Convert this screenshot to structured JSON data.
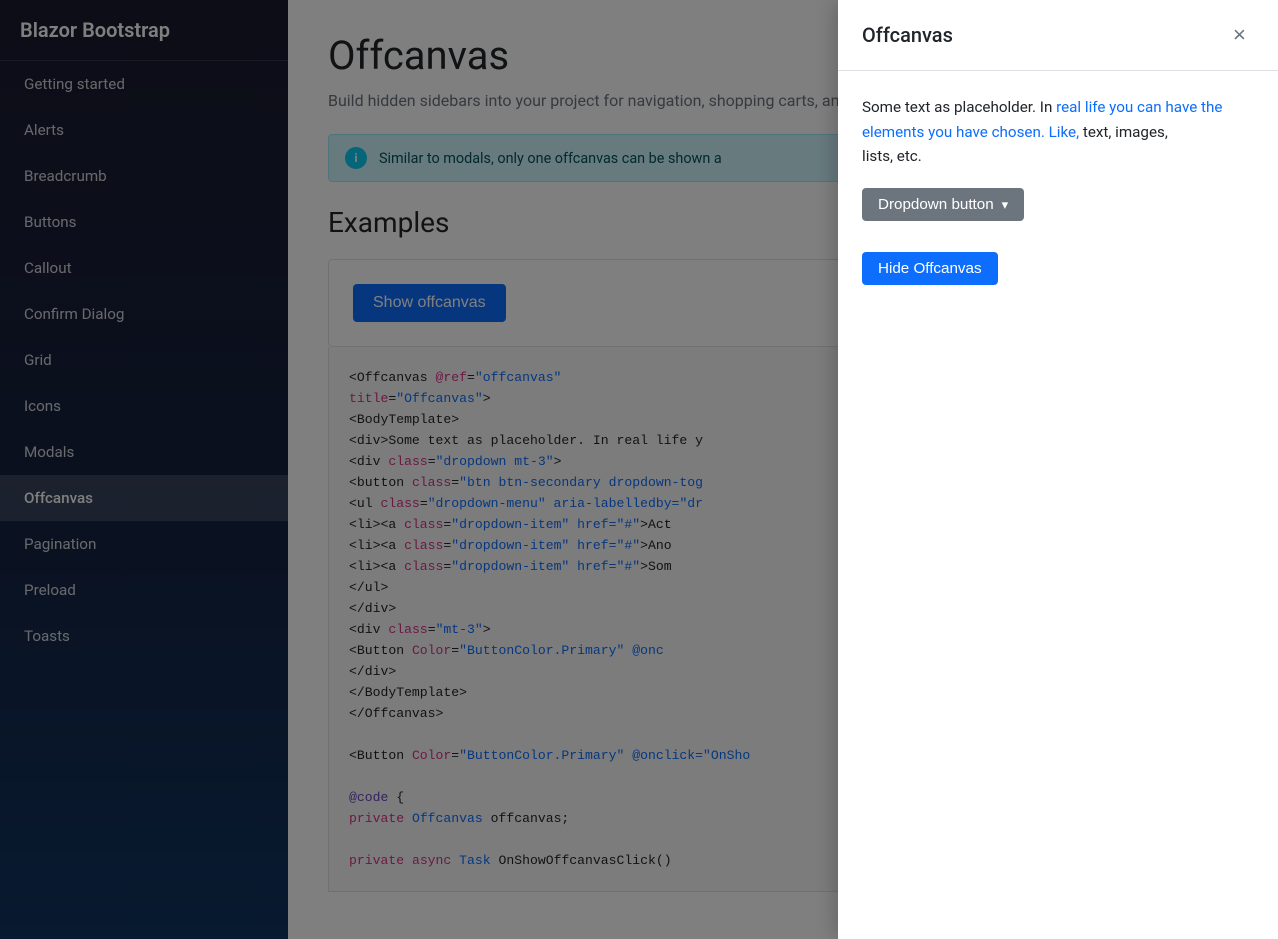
{
  "app": {
    "title": "Blazor Bootstrap"
  },
  "sidebar": {
    "items": [
      {
        "id": "getting-started",
        "label": "Getting started",
        "active": false
      },
      {
        "id": "alerts",
        "label": "Alerts",
        "active": false
      },
      {
        "id": "breadcrumb",
        "label": "Breadcrumb",
        "active": false
      },
      {
        "id": "buttons",
        "label": "Buttons",
        "active": false
      },
      {
        "id": "callout",
        "label": "Callout",
        "active": false
      },
      {
        "id": "confirm-dialog",
        "label": "Confirm Dialog",
        "active": false
      },
      {
        "id": "grid",
        "label": "Grid",
        "active": false
      },
      {
        "id": "icons",
        "label": "Icons",
        "active": false
      },
      {
        "id": "modals",
        "label": "Modals",
        "active": false
      },
      {
        "id": "offcanvas",
        "label": "Offcanvas",
        "active": true
      },
      {
        "id": "pagination",
        "label": "Pagination",
        "active": false
      },
      {
        "id": "preload",
        "label": "Preload",
        "active": false
      },
      {
        "id": "toasts",
        "label": "Toasts",
        "active": false
      }
    ]
  },
  "main": {
    "page_title": "Offcanvas",
    "page_subtitle": "Build hidden sidebars into your project for navigation, shopping carts, and more.",
    "info_text": "Similar to modals, only one offcanvas can be shown a",
    "examples_title": "Examples",
    "show_btn_label": "Show offcanvas"
  },
  "offcanvas": {
    "title": "Offcanvas",
    "body_text_plain": "Some text as placeholder. In real life you can have the elements you have chosen. Like, text, images, lists, etc.",
    "body_text_highlighted_words": [
      "real",
      "life",
      "you",
      "can",
      "have",
      "the",
      "elements",
      "you",
      "have",
      "chosen.",
      "Like,",
      "text,",
      "images,"
    ],
    "dropdown_btn_label": "Dropdown button",
    "hide_btn_label": "Hide Offcanvas",
    "close_icon": "×"
  },
  "code": {
    "lines": [
      {
        "parts": [
          {
            "type": "tag",
            "text": "<Offcanvas "
          },
          {
            "type": "attr",
            "text": "@ref"
          },
          {
            "type": "tag",
            "text": "="
          },
          {
            "type": "val",
            "text": "\"offcanvas\""
          }
        ]
      },
      {
        "parts": [
          {
            "type": "tag",
            "text": "         "
          },
          {
            "type": "attr",
            "text": "title"
          },
          {
            "type": "tag",
            "text": "="
          },
          {
            "type": "val",
            "text": "\"Offcanvas\""
          },
          {
            "type": "tag",
            "text": ">"
          }
        ]
      },
      {
        "parts": [
          {
            "type": "tag",
            "text": "    <BodyTemplate>"
          }
        ]
      },
      {
        "parts": [
          {
            "type": "tag",
            "text": "        <div>Some text as placeholder. In real life y"
          }
        ]
      },
      {
        "parts": [
          {
            "type": "tag",
            "text": "        <div "
          },
          {
            "type": "attr",
            "text": "class"
          },
          {
            "type": "tag",
            "text": "="
          },
          {
            "type": "val",
            "text": "\"dropdown mt-3\""
          },
          {
            "type": "tag",
            "text": ">"
          }
        ]
      },
      {
        "parts": [
          {
            "type": "tag",
            "text": "            <button "
          },
          {
            "type": "attr",
            "text": "class"
          },
          {
            "type": "tag",
            "text": "="
          },
          {
            "type": "val",
            "text": "\"btn btn-secondary dropdown-tog"
          }
        ]
      },
      {
        "parts": [
          {
            "type": "tag",
            "text": "            <ul "
          },
          {
            "type": "attr",
            "text": "class"
          },
          {
            "type": "tag",
            "text": "="
          },
          {
            "type": "val",
            "text": "\"dropdown-menu\" aria-labelledby="
          },
          {
            "type": "val",
            "text": "\"dr"
          }
        ]
      },
      {
        "parts": [
          {
            "type": "tag",
            "text": "                <li><a "
          },
          {
            "type": "attr",
            "text": "class"
          },
          {
            "type": "tag",
            "text": "="
          },
          {
            "type": "val",
            "text": "\"dropdown-item\" href=\"#\""
          },
          {
            "type": "tag",
            "text": ">Act"
          }
        ]
      },
      {
        "parts": [
          {
            "type": "tag",
            "text": "                <li><a "
          },
          {
            "type": "attr",
            "text": "class"
          },
          {
            "type": "tag",
            "text": "="
          },
          {
            "type": "val",
            "text": "\"dropdown-item\" href=\"#\""
          },
          {
            "type": "tag",
            "text": ">Ano"
          }
        ]
      },
      {
        "parts": [
          {
            "type": "tag",
            "text": "                <li><a "
          },
          {
            "type": "attr",
            "text": "class"
          },
          {
            "type": "tag",
            "text": "="
          },
          {
            "type": "val",
            "text": "\"dropdown-item\" href=\"#\""
          },
          {
            "type": "tag",
            "text": ">Som"
          }
        ]
      },
      {
        "parts": [
          {
            "type": "tag",
            "text": "            </ul>"
          }
        ]
      },
      {
        "parts": [
          {
            "type": "tag",
            "text": "        </div>"
          }
        ]
      },
      {
        "parts": [
          {
            "type": "tag",
            "text": "        <div "
          },
          {
            "type": "attr",
            "text": "class"
          },
          {
            "type": "tag",
            "text": "="
          },
          {
            "type": "val",
            "text": "\"mt-3\""
          },
          {
            "type": "tag",
            "text": ">"
          }
        ]
      },
      {
        "parts": [
          {
            "type": "tag",
            "text": "            <Button "
          },
          {
            "type": "attr",
            "text": "Color"
          },
          {
            "type": "tag",
            "text": "="
          },
          {
            "type": "val",
            "text": "\"ButtonColor.Primary\" @onc"
          }
        ]
      },
      {
        "parts": [
          {
            "type": "tag",
            "text": "        </div>"
          }
        ]
      },
      {
        "parts": [
          {
            "type": "tag",
            "text": "    </BodyTemplate>"
          }
        ]
      },
      {
        "parts": [
          {
            "type": "tag",
            "text": "</Offcanvas>"
          }
        ]
      },
      {
        "parts": []
      },
      {
        "parts": [
          {
            "type": "tag",
            "text": "<Button "
          },
          {
            "type": "attr",
            "text": "Color"
          },
          {
            "type": "tag",
            "text": "="
          },
          {
            "type": "val",
            "text": "\"ButtonColor.Primary\" @onclick=\"OnSho"
          }
        ]
      },
      {
        "parts": []
      },
      {
        "parts": [
          {
            "type": "at-kw",
            "text": "@code"
          },
          {
            "type": "tag",
            "text": " {"
          }
        ]
      },
      {
        "parts": [
          {
            "type": "tag",
            "text": "    "
          },
          {
            "type": "kw",
            "text": "private"
          },
          {
            "type": "tag",
            "text": " "
          },
          {
            "type": "blue",
            "text": "Offcanvas"
          },
          {
            "type": "tag",
            "text": " offcanvas;"
          }
        ]
      },
      {
        "parts": []
      },
      {
        "parts": [
          {
            "type": "tag",
            "text": "    "
          },
          {
            "type": "kw",
            "text": "private"
          },
          {
            "type": "tag",
            "text": " "
          },
          {
            "type": "kw",
            "text": "async"
          },
          {
            "type": "tag",
            "text": " "
          },
          {
            "type": "blue",
            "text": "Task"
          },
          {
            "type": "tag",
            "text": " OnShowOffcanvasClick()"
          }
        ]
      }
    ]
  },
  "colors": {
    "sidebar_bg_start": "#1a1a2e",
    "sidebar_bg_end": "#0f3460",
    "active_bg": "rgba(255,255,255,0.15)",
    "primary": "#0d6efd",
    "secondary": "#6c757d",
    "info": "#0dcaf0"
  }
}
